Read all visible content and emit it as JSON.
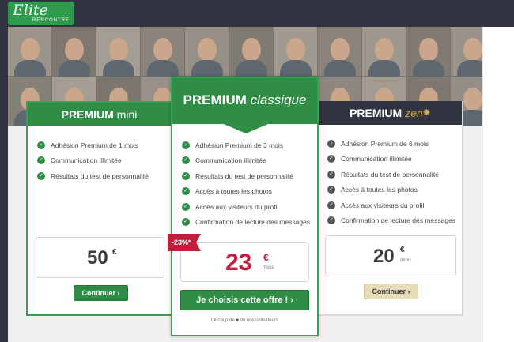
{
  "header": {
    "logo": "Elite",
    "logo_sub": "RENCONTRE"
  },
  "plans": {
    "mini": {
      "title_bold": "PREMIUM",
      "title_light": "mini",
      "features": [
        "Adhésion Premium de 1 mois",
        "Communication illimitée",
        "Résultats du test de personnalité"
      ],
      "price": "50",
      "currency": "€",
      "button": "Continuer ›"
    },
    "classique": {
      "title_bold": "PREMIUM",
      "title_light": "classique",
      "features": [
        "Adhésion Premium de 3 mois",
        "Communication illimitée",
        "Résultats du test de personnalité",
        "Accès à toutes les photos",
        "Accès aux visiteurs du profil",
        "Confirmation de lecture des messages"
      ],
      "promo": "-23%*",
      "price": "23",
      "currency": "€",
      "per": "/mois",
      "button": "Je choisis cette offre ! ›",
      "note_before": "Le coup de",
      "note_after": "de nos utilisateurs"
    },
    "zen": {
      "title_bold": "PREMIUM",
      "title_light": "zen",
      "features": [
        "Adhésion Premium de 6 mois",
        "Communication illimitée",
        "Résultats du test de personnalité",
        "Accès à toutes les photos",
        "Accès aux visiteurs du profil",
        "Confirmation de lecture des messages"
      ],
      "price": "20",
      "currency": "€",
      "per": "/mois",
      "button": "Continuer ›"
    }
  },
  "icons": {
    "check": "check-circle-icon",
    "heart": "heart-icon",
    "star": "star-icon"
  },
  "colors": {
    "brand_green": "#2f8d45",
    "dark": "#2f3440",
    "promo_red": "#c11d3c",
    "zen_gold": "#d9a93a"
  }
}
